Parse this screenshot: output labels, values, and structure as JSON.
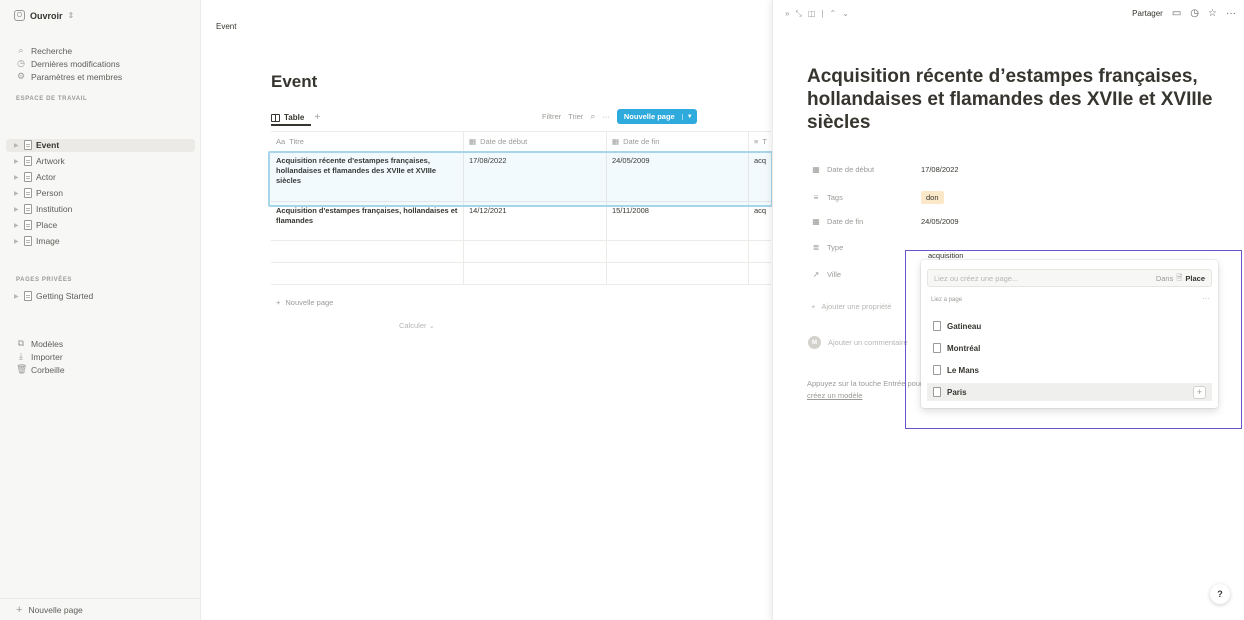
{
  "sidebar": {
    "workspace": "Ouvroir",
    "workspace_icon": "O",
    "nav": [
      {
        "label": "Recherche",
        "icon": "search-icon"
      },
      {
        "label": "Dernières modifications",
        "icon": "clock-icon"
      },
      {
        "label": "Paramètres et membres",
        "icon": "gear-icon"
      }
    ],
    "section_workspace": "ESPACE DE TRAVAIL",
    "pages": [
      "Event",
      "Artwork",
      "Actor",
      "Person",
      "Institution",
      "Place",
      "Image"
    ],
    "section_private": "PAGES PRIVÉES",
    "private_pages": [
      "Getting Started"
    ],
    "tools": [
      {
        "label": "Modèles",
        "icon": "templates-icon"
      },
      {
        "label": "Importer",
        "icon": "import-icon"
      },
      {
        "label": "Corbeille",
        "icon": "trash-icon"
      }
    ],
    "new_page": "Nouvelle page"
  },
  "main": {
    "breadcrumb": "Event",
    "title": "Event",
    "view_tab": "Table",
    "toolbar": {
      "filter": "Filtrer",
      "sort": "Trier",
      "new_page": "Nouvelle page"
    },
    "columns": [
      "Titre",
      "Date de début",
      "Date de fin",
      "T"
    ],
    "rows": [
      {
        "title": "Acquisition récente d'estampes françaises, hollandaises et flamandes des XVIIe et XVIIIe siècles",
        "start": "17/08/2022",
        "end": "24/05/2009",
        "type": "acq"
      },
      {
        "title": "Acquisition d'estampes françaises, hollandaises et flamandes",
        "start": "14/12/2021",
        "end": "15/11/2008",
        "type": "acq"
      }
    ],
    "new_row": "Nouvelle page",
    "calculate": "Calculer"
  },
  "peek": {
    "share": "Partager",
    "title": "Acquisition récente d’estampes françaises, hollandaises et flamandes des XVIIe et XVIIIe siècles",
    "props": {
      "start_label": "Date de début",
      "start_value": "17/08/2022",
      "tags_label": "Tags",
      "tags_value": "don",
      "end_label": "Date de fin",
      "end_value": "24/05/2009",
      "type_label": "Type",
      "type_value": "acquisition",
      "ville_label": "Ville"
    },
    "add_property": "Ajouter une propriété",
    "add_comment": "Ajouter un commentaire",
    "hint_line1": "Appuyez sur la touche Entrée pour continuer avec une page vide, ou",
    "hint_link": "créez un modèle",
    "help": "?"
  },
  "popup": {
    "placeholder": "Liez ou créez une page...",
    "in_label": "Dans",
    "in_db": "Place",
    "section": "Liez a page",
    "more": "···",
    "items": [
      "Gatineau",
      "Montréal",
      "Le Mans",
      "Paris"
    ],
    "plus": "+"
  },
  "colors": {
    "accent": "#2eaadc",
    "sidebar_bg": "#f7f7f5",
    "tag_bg": "#fbe8c9",
    "outline": "#6b54c8"
  }
}
